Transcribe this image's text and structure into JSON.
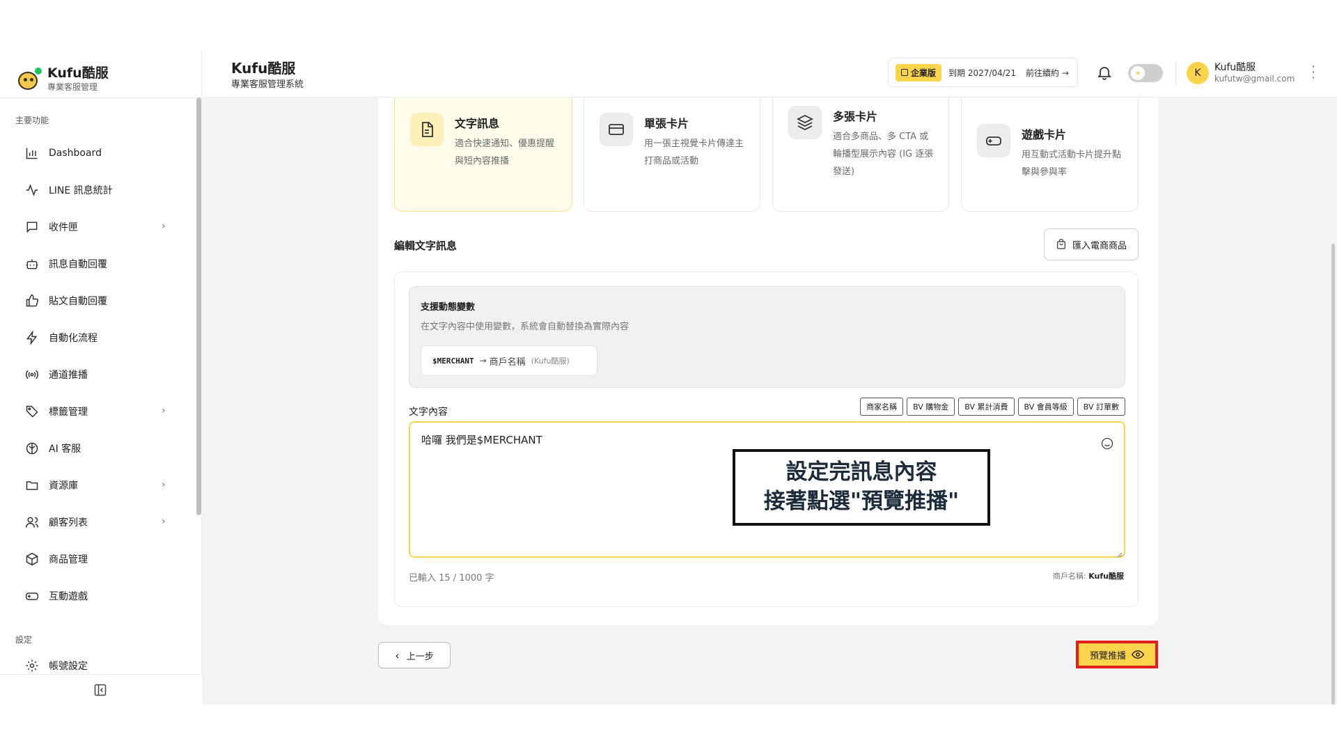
{
  "sidebar": {
    "brand_title": "Kufu酷服",
    "brand_sub": "專業客服管理",
    "section_main": "主要功能",
    "section_settings": "設定",
    "items": [
      {
        "label": "Dashboard",
        "icon": "bar-chart-icon",
        "expandable": false
      },
      {
        "label": "LINE 訊息統計",
        "icon": "activity-icon",
        "expandable": false
      },
      {
        "label": "收件匣",
        "icon": "message-square-icon",
        "expandable": true
      },
      {
        "label": "訊息自動回覆",
        "icon": "bot-icon",
        "expandable": false
      },
      {
        "label": "貼文自動回覆",
        "icon": "thumbs-up-icon",
        "expandable": false
      },
      {
        "label": "自動化流程",
        "icon": "zap-icon",
        "expandable": false
      },
      {
        "label": "通道推播",
        "icon": "broadcast-icon",
        "expandable": false
      },
      {
        "label": "標籤管理",
        "icon": "tags-icon",
        "expandable": true
      },
      {
        "label": "AI 客服",
        "icon": "ai-icon",
        "expandable": false
      },
      {
        "label": "資源庫",
        "icon": "folder-icon",
        "expandable": true
      },
      {
        "label": "顧客列表",
        "icon": "users-icon",
        "expandable": true
      },
      {
        "label": "商品管理",
        "icon": "package-icon",
        "expandable": false
      },
      {
        "label": "互動遊戲",
        "icon": "gamepad-icon",
        "expandable": false
      },
      {
        "label": "帳號設定",
        "icon": "gear-icon",
        "expandable": false
      }
    ]
  },
  "header": {
    "title": "Kufu酷服",
    "subtitle": "專業客服管理系統",
    "plan_badge": "企業版",
    "plan_expiry": "到期 2027/04/21",
    "plan_link": "前往續約 →",
    "user_initial": "K",
    "user_name": "Kufu酷服",
    "user_email": "kufutw@gmail.com"
  },
  "message_types": [
    {
      "title": "文字訊息",
      "desc": "適合快速通知、優惠提醒與短內容推播",
      "icon": "file-text-icon",
      "selected": true
    },
    {
      "title": "單張卡片",
      "desc": "用一張主視覺卡片傳達主打商品或活動",
      "icon": "credit-card-icon",
      "selected": false
    },
    {
      "title": "多張卡片",
      "desc": "適合多商品、多 CTA 或輪播型展示內容 (IG 逐張發送)",
      "icon": "layers-icon",
      "selected": false
    },
    {
      "title": "遊戲卡片",
      "desc": "用互動式活動卡片提升點擊與參與率",
      "icon": "gamepad-icon",
      "selected": false
    }
  ],
  "editor": {
    "section_title": "編輯文字訊息",
    "import_button": "匯入電商商品",
    "vars_title": "支援動態變數",
    "vars_desc": "在文字內容中使用變數，系統會自動替換為實際內容",
    "var_code": "$MERCHANT",
    "var_arrow": "→",
    "var_name": "商戶名稱",
    "var_example": "(Kufu酷服)",
    "content_label": "文字內容",
    "tags": [
      "商家名稱",
      "BV 購物金",
      "BV 累計消費",
      "BV 會員等級",
      "BV 訂單數"
    ],
    "text_value": "哈囉 我們是$MERCHANT",
    "annotation_line1": "設定完訊息內容",
    "annotation_line2": "接著點選\"預覽推播\"",
    "char_count": "已輸入 15 / 1000 字",
    "merchant_label": "商戶名稱: ",
    "merchant_value": "Kufu酷服"
  },
  "footer": {
    "back_label": "上一步",
    "preview_label": "預覽推播"
  },
  "colors": {
    "accent": "#fcd34d",
    "highlight_border": "#e11d1d",
    "selected_card_bg": "#fffcec"
  }
}
